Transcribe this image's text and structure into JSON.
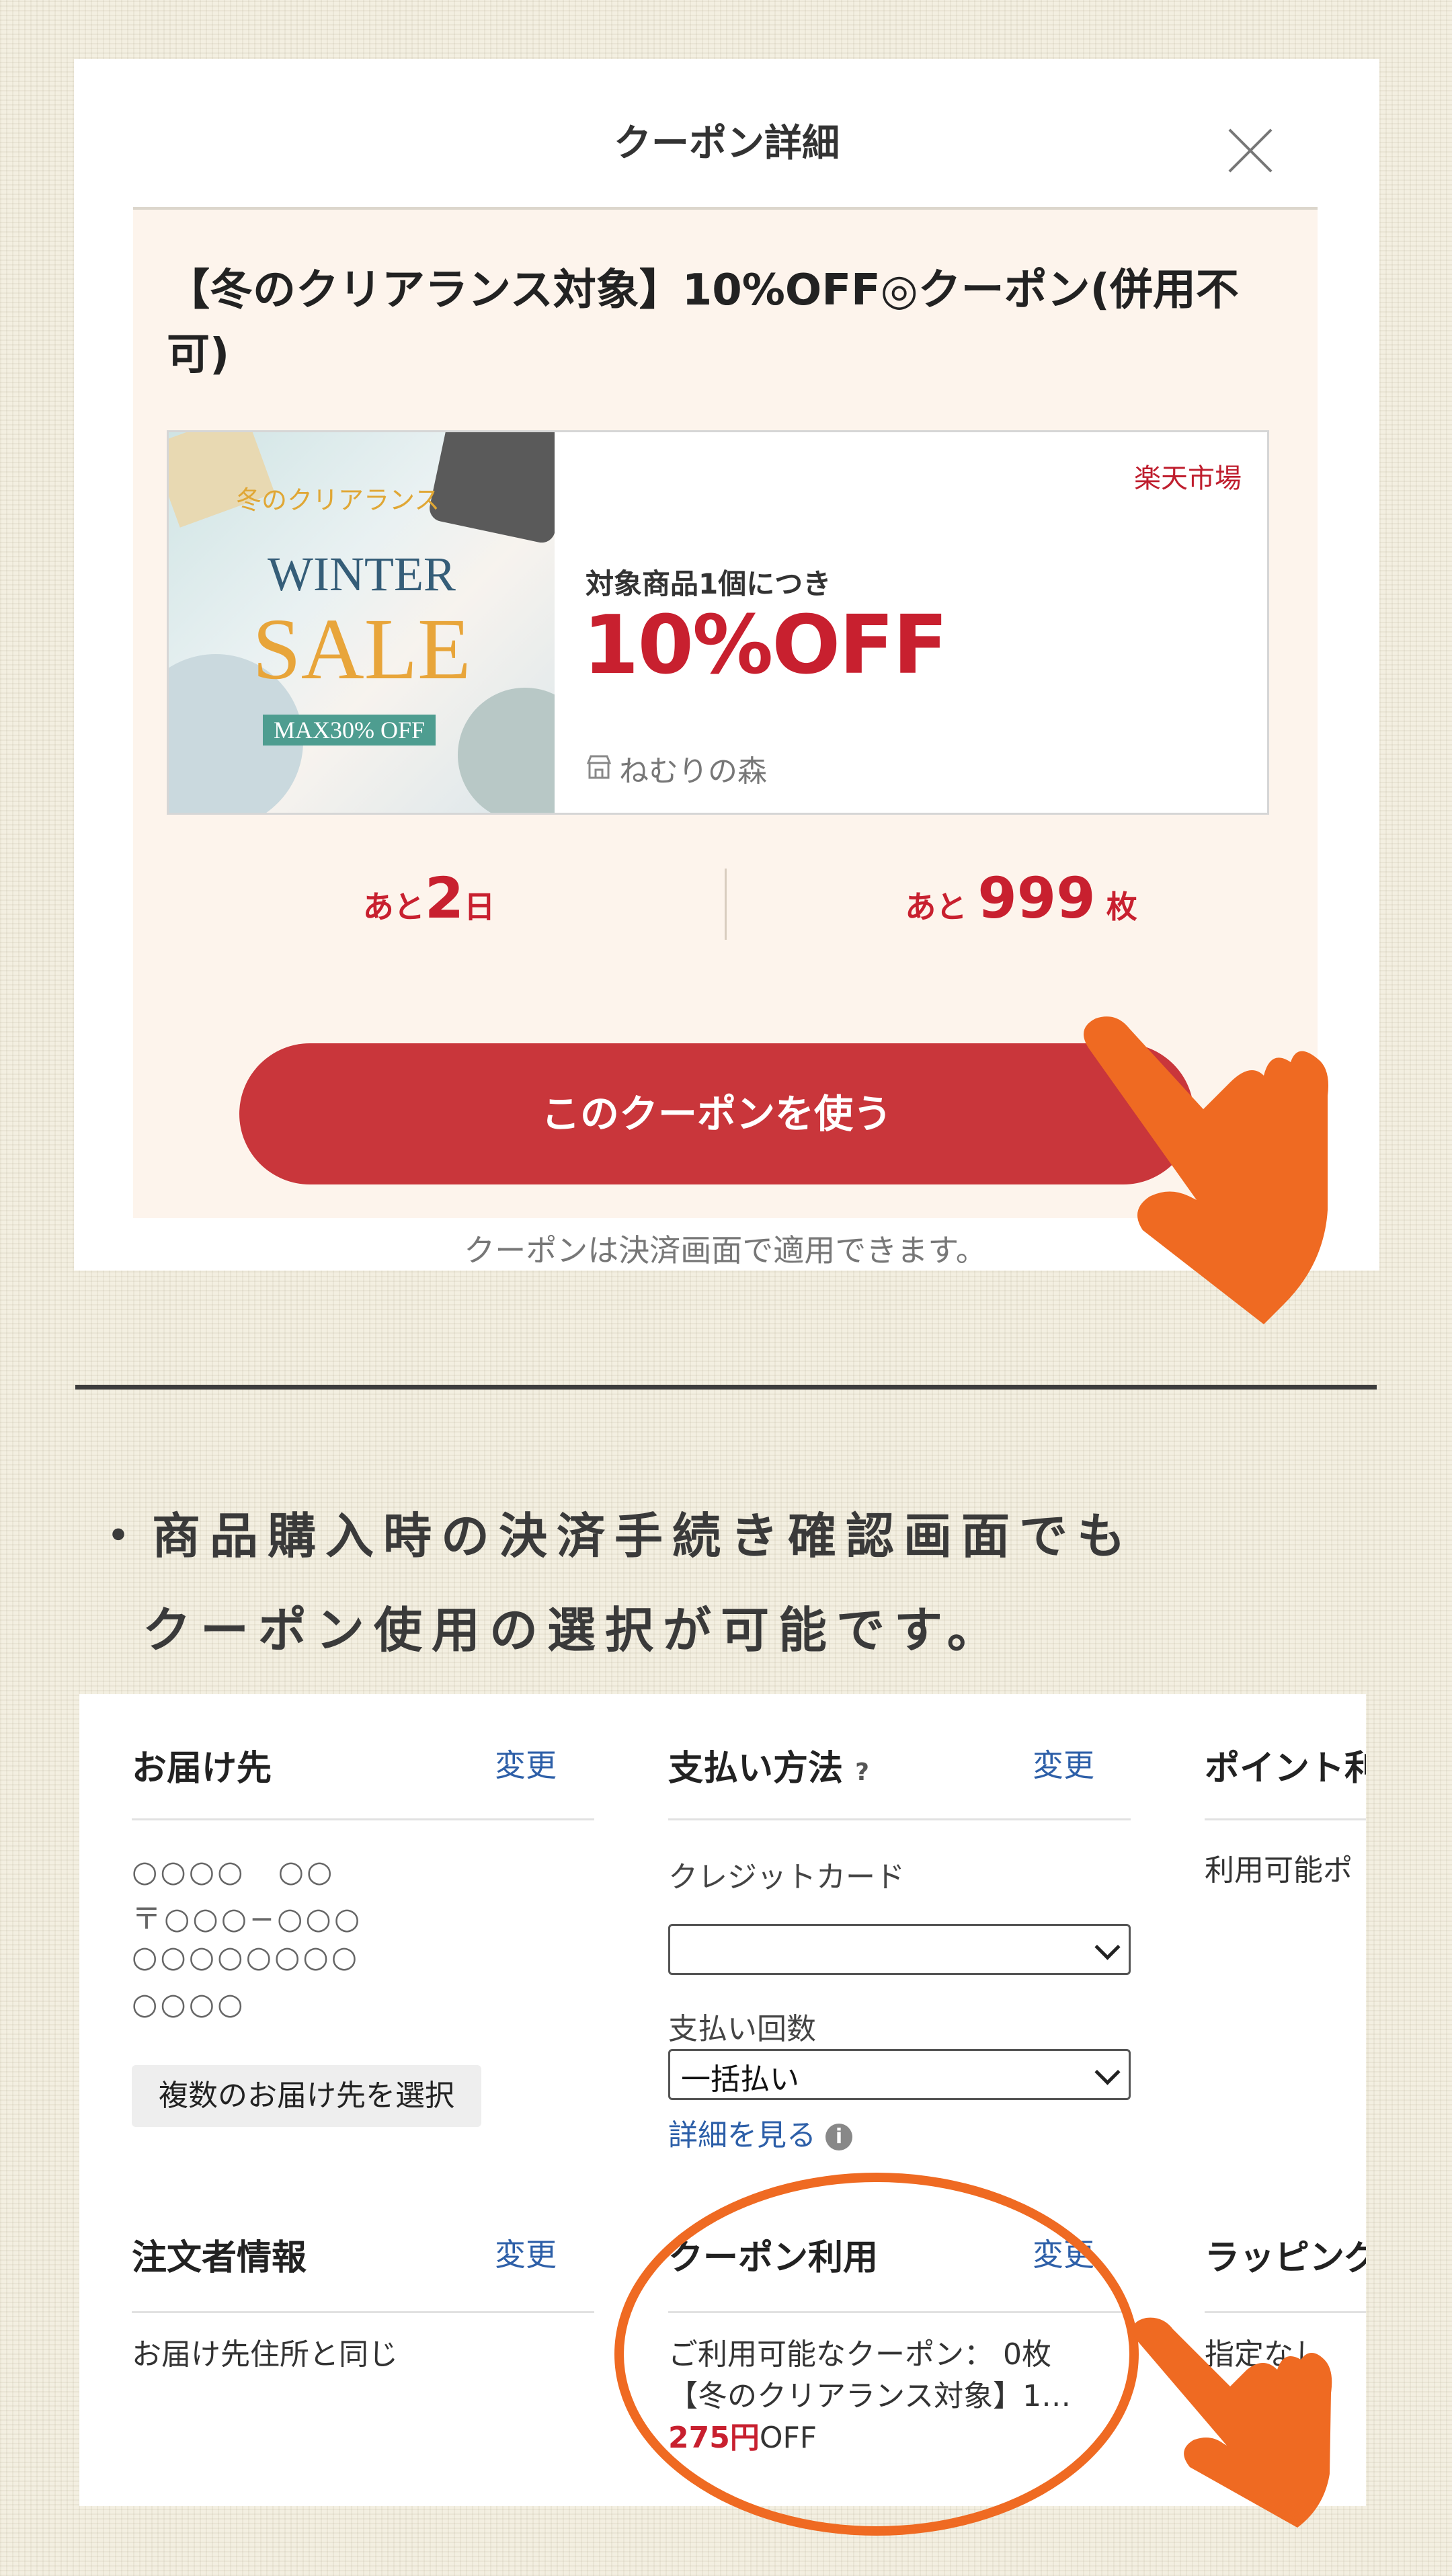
{
  "modal": {
    "title": "クーポン詳細",
    "coupon_title": "【冬のクリアランス対象】10%OFF◎クーポン(併用不可)",
    "image": {
      "top_text": "冬のクリアランス",
      "line1": "WINTER",
      "line2": "SALE",
      "badge": "MAX30% OFF"
    },
    "brand": "楽天市場",
    "condition": "対象商品1個につき",
    "discount": "10%OFF",
    "shop_name": "ねむりの森",
    "days_prefix": "あと",
    "days_value": "2",
    "days_suffix": "日",
    "count_prefix": "あと",
    "count_value": "999",
    "count_suffix": "枚",
    "use_button": "このクーポンを使う",
    "note": "クーポンは決済画面で適用できます。"
  },
  "description": {
    "line1": "・商品購入時の決済手続き確認画面でも",
    "line2": "クーポン使用の選択が可能です。"
  },
  "checkout": {
    "delivery": {
      "title": "お届け先",
      "change": "変更",
      "lines": [
        "○○○○　○○",
        "〒○○○−○○○",
        "○○○○○○○○",
        "○○○○"
      ],
      "multi_button": "複数のお届け先を選択"
    },
    "payment": {
      "title": "支払い方法",
      "help_icon": "?",
      "change": "変更",
      "method": "クレジットカード",
      "card_select_value": "",
      "installments_label": "支払い回数",
      "installments_value": "一括払い",
      "details_link": "詳細を見る",
      "info_icon": "i"
    },
    "points": {
      "title": "ポイント利",
      "text": "利用可能ポ"
    },
    "orderer": {
      "title": "注文者情報",
      "change": "変更",
      "text": "お届け先住所と同じ"
    },
    "coupon": {
      "title": "クーポン利用",
      "change": "変更",
      "available": "ご利用可能なクーポン：  0枚",
      "selected": "【冬のクリアランス対象】1…",
      "off_amount": "275円",
      "off_suffix": "OFF"
    },
    "wrapping": {
      "title": "ラッピング",
      "text": "指定なし"
    }
  },
  "colors": {
    "accent_red": "#c9363b",
    "discount_red": "#c8202f",
    "link_blue": "#2d5fa8",
    "pointer_orange": "#ef6a22",
    "modal_inner_bg": "#fdf4ec"
  },
  "icons": [
    "close-icon",
    "shop-icon",
    "help-icon",
    "info-icon",
    "chevron-down-icon",
    "pointing-hand-icon"
  ]
}
